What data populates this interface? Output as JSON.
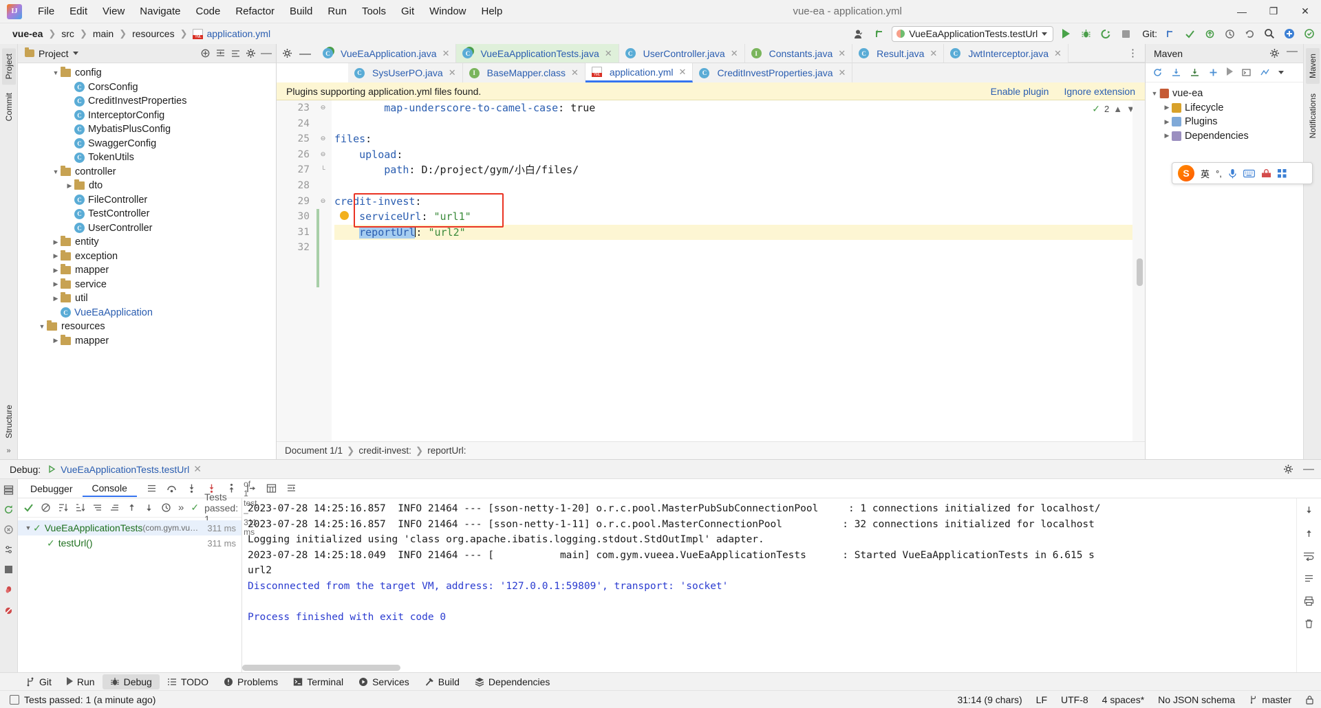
{
  "window": {
    "title": "vue-ea - application.yml",
    "app_icon": "intellij-idea-logo",
    "minimize": "—",
    "maximize": "❐",
    "close": "✕"
  },
  "menu": [
    {
      "label": "File"
    },
    {
      "label": "Edit"
    },
    {
      "label": "View"
    },
    {
      "label": "Navigate"
    },
    {
      "label": "Code"
    },
    {
      "label": "Refactor"
    },
    {
      "label": "Build"
    },
    {
      "label": "Run"
    },
    {
      "label": "Tools"
    },
    {
      "label": "Git"
    },
    {
      "label": "Window"
    },
    {
      "label": "Help"
    }
  ],
  "navbar": {
    "breadcrumbs": [
      "vue-ea",
      "src",
      "main",
      "resources",
      "application.yml"
    ],
    "run_config": "VueEaApplicationTests.testUrl",
    "git_label": "Git:",
    "buttons": [
      "run",
      "debug",
      "run-with-coverage",
      "stop",
      "git-update",
      "git-commit",
      "git-push",
      "history",
      "rollback",
      "search",
      "settings-plugin"
    ]
  },
  "left_strip": {
    "tabs": [
      "Project",
      "Commit"
    ]
  },
  "project_panel": {
    "title": "Project",
    "tree": [
      {
        "indent": 2,
        "arrow": "open",
        "kind": "folder",
        "label": "config"
      },
      {
        "indent": 3,
        "arrow": "none",
        "kind": "class",
        "label": "CorsConfig"
      },
      {
        "indent": 3,
        "arrow": "none",
        "kind": "class",
        "label": "CreditInvestProperties"
      },
      {
        "indent": 3,
        "arrow": "none",
        "kind": "class",
        "label": "InterceptorConfig"
      },
      {
        "indent": 3,
        "arrow": "none",
        "kind": "class",
        "label": "MybatisPlusConfig"
      },
      {
        "indent": 3,
        "arrow": "none",
        "kind": "class",
        "label": "SwaggerConfig"
      },
      {
        "indent": 3,
        "arrow": "none",
        "kind": "class",
        "label": "TokenUtils"
      },
      {
        "indent": 2,
        "arrow": "open",
        "kind": "folder",
        "label": "controller"
      },
      {
        "indent": 3,
        "arrow": "closed",
        "kind": "folder",
        "label": "dto"
      },
      {
        "indent": 3,
        "arrow": "none",
        "kind": "class",
        "label": "FileController"
      },
      {
        "indent": 3,
        "arrow": "none",
        "kind": "class",
        "label": "TestController"
      },
      {
        "indent": 3,
        "arrow": "none",
        "kind": "class",
        "label": "UserController"
      },
      {
        "indent": 2,
        "arrow": "closed",
        "kind": "folder",
        "label": "entity"
      },
      {
        "indent": 2,
        "arrow": "closed",
        "kind": "folder",
        "label": "exception"
      },
      {
        "indent": 2,
        "arrow": "closed",
        "kind": "folder",
        "label": "mapper"
      },
      {
        "indent": 2,
        "arrow": "closed",
        "kind": "folder",
        "label": "service"
      },
      {
        "indent": 2,
        "arrow": "closed",
        "kind": "folder",
        "label": "util"
      },
      {
        "indent": 2,
        "arrow": "none",
        "kind": "class-blue",
        "label": "VueEaApplication"
      },
      {
        "indent": 1,
        "arrow": "open",
        "kind": "folder",
        "label": "resources"
      },
      {
        "indent": 2,
        "arrow": "closed",
        "kind": "folder",
        "label": "mapper"
      }
    ]
  },
  "editor": {
    "tabs_row1": [
      {
        "label": "VueEaApplication.java",
        "icon": "java-class-run-icon",
        "state": "normal"
      },
      {
        "label": "VueEaApplicationTests.java",
        "icon": "java-test-class-icon",
        "state": "active-green"
      },
      {
        "label": "UserController.java",
        "icon": "java-class-icon",
        "state": "normal"
      },
      {
        "label": "Constants.java",
        "icon": "java-interface-icon",
        "state": "normal"
      },
      {
        "label": "Result.java",
        "icon": "java-class-icon",
        "state": "normal"
      },
      {
        "label": "JwtInterceptor.java",
        "icon": "java-class-icon",
        "state": "normal"
      }
    ],
    "tabs_row2": [
      {
        "label": "SysUserPO.java",
        "icon": "java-class-icon",
        "state": "normal"
      },
      {
        "label": "BaseMapper.class",
        "icon": "java-interface-icon",
        "state": "normal"
      },
      {
        "label": "application.yml",
        "icon": "yml-file-icon",
        "state": "active-yml"
      },
      {
        "label": "CreditInvestProperties.java",
        "icon": "java-class-icon",
        "state": "normal"
      }
    ],
    "notification": {
      "message": "Plugins supporting application.yml files found.",
      "enable_label": "Enable plugin",
      "ignore_label": "Ignore extension"
    },
    "inspection_count": "2",
    "lines": [
      {
        "no": "23",
        "text": "        map-underscore-to-camel-case: true",
        "type": "kv-bool",
        "fold": "minus"
      },
      {
        "no": "24",
        "text": "",
        "type": "blank",
        "fold": ""
      },
      {
        "no": "25",
        "text": "files:",
        "type": "key",
        "fold": "minus"
      },
      {
        "no": "26",
        "text": "    upload:",
        "type": "key",
        "fold": "minus"
      },
      {
        "no": "27",
        "text": "        path: D:/project/gym/小白/files/",
        "type": "kv-plain",
        "fold": "bottom"
      },
      {
        "no": "28",
        "text": "",
        "type": "blank",
        "fold": ""
      },
      {
        "no": "29",
        "text": "credit-invest:",
        "type": "key",
        "fold": "minus"
      },
      {
        "no": "30",
        "text": "    serviceUrl: \"url1\"",
        "type": "kv-str",
        "fold": ""
      },
      {
        "no": "31",
        "text": "    reportUrl: \"url2\"",
        "type": "kv-str-sel",
        "fold": ""
      },
      {
        "no": "32",
        "text": "",
        "type": "blank",
        "fold": ""
      }
    ],
    "code_tokens": {
      "l23_key": "map-underscore-to-camel-case",
      "l23_val": "true",
      "l25_key": "files",
      "l26_key": "upload",
      "l27_key": "path",
      "l27_val": "D:/project/gym/小白/files/",
      "l29_key": "credit-invest",
      "l30_key": "serviceUrl",
      "l30_val": "\"url1\"",
      "l31_key": "reportUrl",
      "l31_val": "\"url2\""
    },
    "breadcrumb": [
      "Document 1/1",
      "credit-invest:",
      "reportUrl:"
    ]
  },
  "maven": {
    "title": "Maven",
    "root": "vue-ea",
    "nodes": [
      "Lifecycle",
      "Plugins",
      "Dependencies"
    ]
  },
  "right_strip": {
    "tabs": [
      "Maven",
      "Notifications"
    ]
  },
  "ime": {
    "engine_icon": "sogou-input-icon",
    "mode": "英",
    "punct": "°,",
    "mic": "mic-icon",
    "keyboard": "keyboard-icon",
    "toolbox": "toolbox-icon",
    "grid": "grid-icon"
  },
  "debug": {
    "label": "Debug:",
    "session_tab": "VueEaApplicationTests.testUrl",
    "tabs": [
      {
        "label": "Debugger",
        "selected": false
      },
      {
        "label": "Console",
        "selected": true
      }
    ],
    "test_status": "Tests passed: 1",
    "test_status_detail": "of 1 test – 311 ms",
    "tree": [
      {
        "label": "VueEaApplicationTests",
        "pkg": "(com.gym.vu…",
        "ms": "311 ms",
        "level": 0,
        "selected": true
      },
      {
        "label": "testUrl()",
        "pkg": "",
        "ms": "311 ms",
        "level": 1,
        "selected": false
      }
    ],
    "console": [
      {
        "text": "2023-07-28 14:25:16.857  INFO 21464 --- [sson-netty-1-20] o.r.c.pool.MasterPubSubConnectionPool     : 1 connections initialized for localhost/",
        "color": "dark"
      },
      {
        "text": "2023-07-28 14:25:16.857  INFO 21464 --- [sson-netty-1-11] o.r.c.pool.MasterConnectionPool          : 32 connections initialized for localhost",
        "color": "dark"
      },
      {
        "text": "Logging initialized using 'class org.apache.ibatis.logging.stdout.StdOutImpl' adapter.",
        "color": "dark"
      },
      {
        "text": "2023-07-28 14:25:18.049  INFO 21464 --- [           main] com.gym.vueea.VueEaApplicationTests      : Started VueEaApplicationTests in 6.615 s",
        "color": "dark"
      },
      {
        "text": "url2",
        "color": "dark"
      },
      {
        "text": "Disconnected from the target VM, address: '127.0.0.1:59809', transport: 'socket'",
        "color": "blue"
      },
      {
        "text": "",
        "color": "dark"
      },
      {
        "text": "Process finished with exit code 0",
        "color": "blue"
      }
    ]
  },
  "toolwindow_bar": [
    {
      "label": "Git",
      "icon": "git-branch-icon",
      "active": false
    },
    {
      "label": "Run",
      "icon": "run-icon",
      "active": false
    },
    {
      "label": "Debug",
      "icon": "debug-bug-icon",
      "active": true
    },
    {
      "label": "TODO",
      "icon": "todo-list-icon",
      "active": false
    },
    {
      "label": "Problems",
      "icon": "problems-icon",
      "active": false
    },
    {
      "label": "Terminal",
      "icon": "terminal-icon",
      "active": false
    },
    {
      "label": "Services",
      "icon": "services-icon",
      "active": false
    },
    {
      "label": "Build",
      "icon": "build-hammer-icon",
      "active": false
    },
    {
      "label": "Dependencies",
      "icon": "dependencies-icon",
      "active": false
    }
  ],
  "statusbar": {
    "message": "Tests passed: 1 (a minute ago)",
    "caret": "31:14 (9 chars)",
    "line_sep": "LF",
    "encoding": "UTF-8",
    "indent": "4 spaces*",
    "schema": "No JSON schema",
    "branch": "master",
    "lock_icon": "lock-icon",
    "branch_icon": "git-branch-icon"
  }
}
